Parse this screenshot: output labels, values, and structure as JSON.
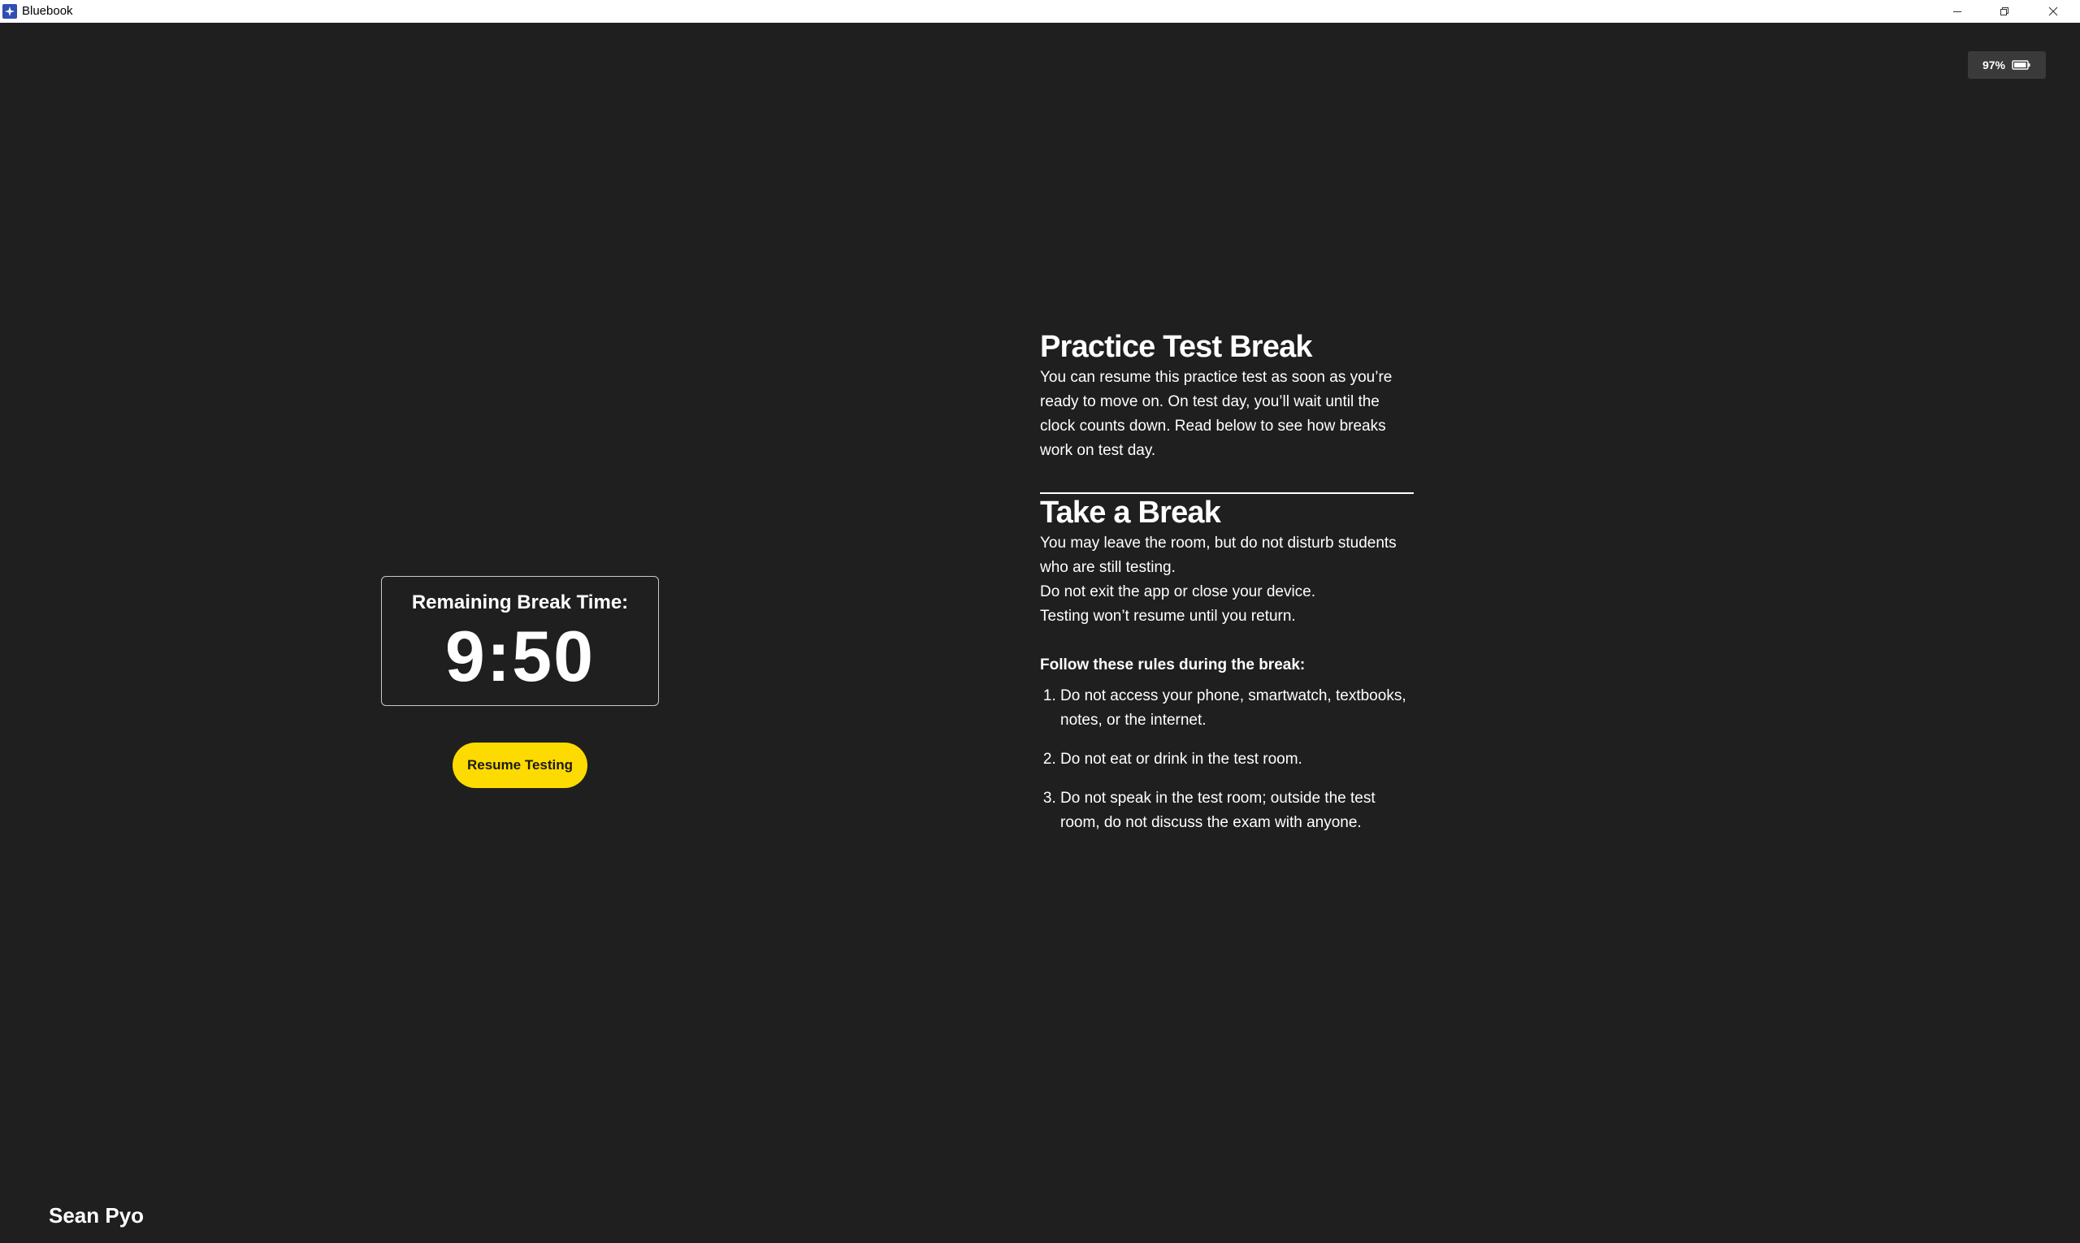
{
  "window": {
    "title": "Bluebook",
    "app_icon": "bluebook-logo-icon",
    "controls": [
      "minimize-icon",
      "restore-icon",
      "close-icon"
    ]
  },
  "battery": {
    "level_text": "97%",
    "level_fraction": 0.97,
    "icon": "battery-icon"
  },
  "timer": {
    "label": "Remaining Break Time:",
    "value": "9:50"
  },
  "resume_button": {
    "label": "Resume Testing",
    "color": "#fedb00"
  },
  "practice_break": {
    "title": "Practice Test Break",
    "body": "You can resume this practice test as soon as you’re ready to move on. On test day, you’ll wait until the clock counts down. Read below to see how breaks work on test day."
  },
  "take_break": {
    "title": "Take a Break",
    "paragraphs": [
      "You may leave the room, but do not disturb students who are still testing.",
      "Do not exit the app or close your device.",
      "Testing won’t resume until you return."
    ],
    "rules_heading": "Follow these rules during the break:",
    "rules": [
      "Do not access your phone, smartwatch, textbooks, notes, or the internet.",
      "Do not eat or drink in the test room.",
      "Do not speak in the test room; outside the test room, do not discuss the exam with anyone."
    ]
  },
  "user": {
    "name": "Sean Pyo"
  },
  "colors": {
    "background": "#1f1f1f",
    "accent": "#fedb00",
    "text": "#ffffff",
    "titlebar": "#ffffff"
  }
}
